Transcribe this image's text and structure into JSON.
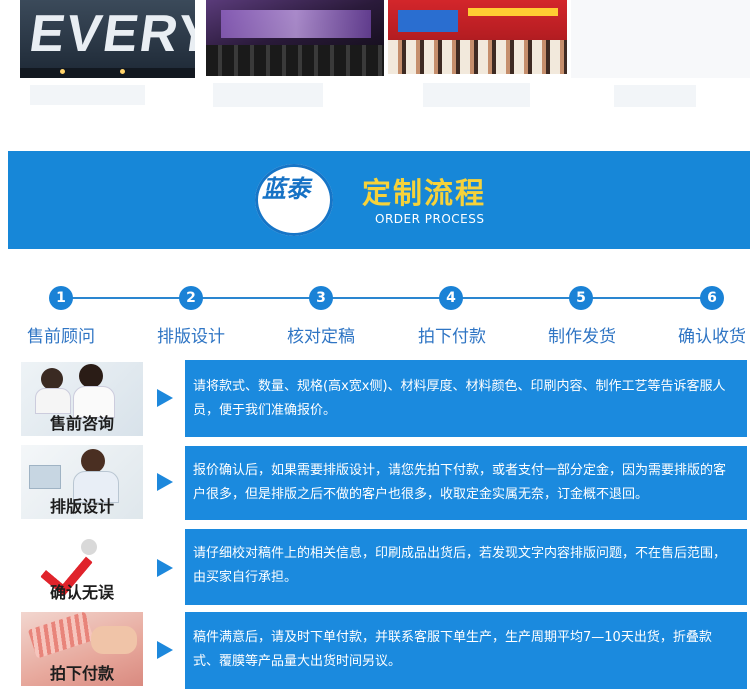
{
  "banner": {
    "logo_text": "蓝泰",
    "title": "定制流程",
    "subtitle": "ORDER PROCESS"
  },
  "top_photos": [
    {
      "sign_text": "EVERY"
    }
  ],
  "steps": [
    {
      "number": "1",
      "label": "售前顾问"
    },
    {
      "number": "2",
      "label": "排版设计"
    },
    {
      "number": "3",
      "label": "核对定稿"
    },
    {
      "number": "4",
      "label": "拍下付款"
    },
    {
      "number": "5",
      "label": "制作发货"
    },
    {
      "number": "6",
      "label": "确认收货"
    }
  ],
  "rows": [
    {
      "thumb_label": "售前咨询",
      "text": "请将款式、数量、规格(高x宽x侧)、材料厚度、材料颜色、印刷内容、制作工艺等告诉客服人员，便于我们准确报价。"
    },
    {
      "thumb_label": "排版设计",
      "text": "报价确认后，如果需要排版设计，请您先拍下付款，或者支付一部分定金，因为需要排版的客户很多，但是排版之后不做的客户也很多，收取定金实属无奈，订金概不退回。"
    },
    {
      "thumb_label": "确认无误",
      "text": "请仔细校对稿件上的相关信息，印刷成品出货后，若发现文字内容排版问题，不在售后范围，由买家自行承担。"
    },
    {
      "thumb_label": "拍下付款",
      "text": "稿件满意后，请及时下单付款，并联系客服下单生产，生产周期平均7—10天出货，折叠款式、覆膜等产品量大出货时间另议。"
    }
  ]
}
